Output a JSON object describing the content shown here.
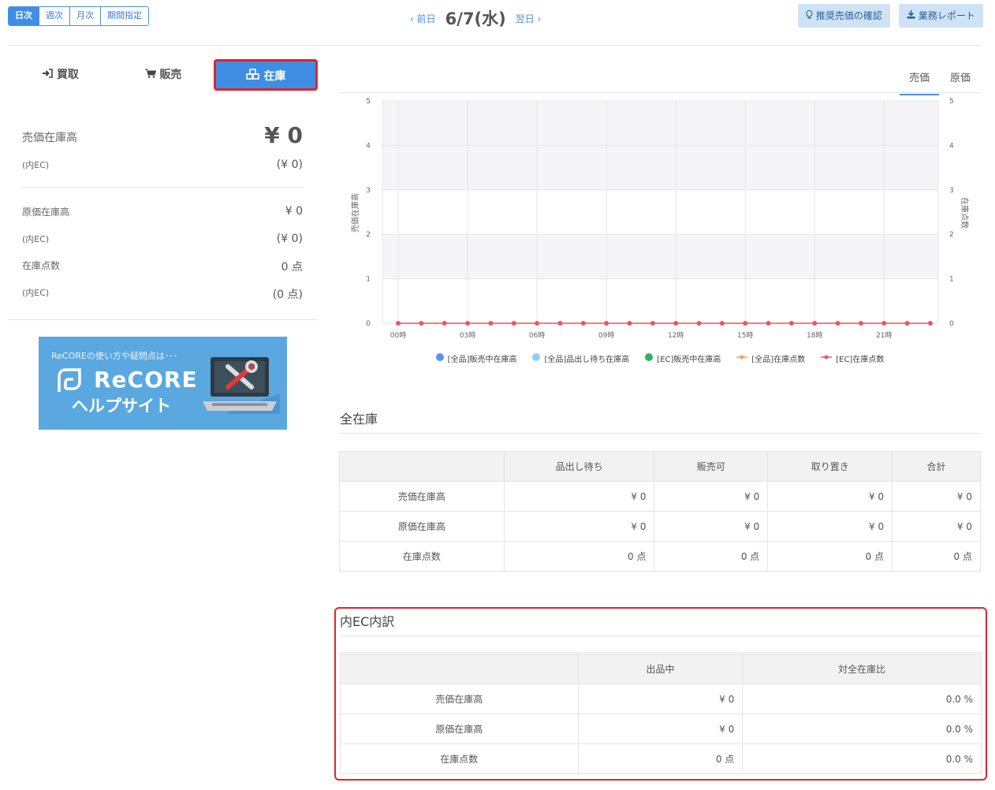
{
  "period": {
    "daily": "日次",
    "weekly": "週次",
    "monthly": "月次",
    "range": "期間指定"
  },
  "date_nav": {
    "prev": "前日",
    "current": "6/7(水)",
    "next": "翌日"
  },
  "top_buttons": {
    "recommend": "推奨売価の確認",
    "report": "業務レポート"
  },
  "left_tabs": {
    "buy": "買取",
    "sell": "販売",
    "stock": "在庫"
  },
  "summary": {
    "sale_stock_label": "売価在庫高",
    "sale_stock_value": "¥ 0",
    "sale_stock_ec_label": "(内EC)",
    "sale_stock_ec_value": "(¥ 0)",
    "cost_stock_label": "原価在庫高",
    "cost_stock_value": "¥ 0",
    "cost_stock_ec_label": "(内EC)",
    "cost_stock_ec_value": "(¥ 0)",
    "count_label": "在庫点数",
    "count_value": "0 点",
    "count_ec_label": "(内EC)",
    "count_ec_value": "(0 点)"
  },
  "banner": {
    "caption": "ReCOREの使い方や疑問点は･･･",
    "brand": "ReCORE",
    "site": "ヘルプサイト"
  },
  "chart_tabs": {
    "sale_price": "売価",
    "cost_price": "原価"
  },
  "chart_data": {
    "type": "line",
    "ylabel": "売価在庫高",
    "y2label": "在庫点数",
    "ylim": [
      0,
      5
    ],
    "y2lim": [
      0,
      5
    ],
    "yticks": [
      "0",
      "1",
      "2",
      "3",
      "4",
      "5"
    ],
    "x_tick_labels": [
      "00時",
      "03時",
      "06時",
      "09時",
      "12時",
      "15時",
      "18時",
      "21時"
    ],
    "x": [
      0,
      1,
      2,
      3,
      4,
      5,
      6,
      7,
      8,
      9,
      10,
      11,
      12,
      13,
      14,
      15,
      16,
      17,
      18,
      19,
      20,
      21,
      22,
      23
    ],
    "legend": [
      "[全品]販売中在庫高",
      "[全品]品出し待ち在庫高",
      "[EC]販売中在庫高",
      "[全品]在庫点数",
      "[EC]在庫点数"
    ],
    "legend_colors": [
      "#5b8ff9",
      "#91cef5",
      "#2fb463",
      "#f7a35c",
      "#f0545a"
    ],
    "series": [
      {
        "name": "[EC]在庫点数",
        "values": [
          0,
          0,
          0,
          0,
          0,
          0,
          0,
          0,
          0,
          0,
          0,
          0,
          0,
          0,
          0,
          0,
          0,
          0,
          0,
          0,
          0,
          0,
          0,
          0
        ]
      }
    ]
  },
  "all_stock": {
    "title": "全在庫",
    "columns": [
      "",
      "品出し待ち",
      "販売可",
      "取り置き",
      "合計"
    ],
    "rows": [
      [
        "売価在庫高",
        "¥ 0",
        "¥ 0",
        "¥ 0",
        "¥ 0"
      ],
      [
        "原価在庫高",
        "¥ 0",
        "¥ 0",
        "¥ 0",
        "¥ 0"
      ],
      [
        "在庫点数",
        "0 点",
        "0 点",
        "0 点",
        "0 点"
      ]
    ]
  },
  "ec_breakdown": {
    "title": "内EC内訳",
    "columns": [
      "",
      "出品中",
      "対全在庫比"
    ],
    "rows": [
      [
        "売価在庫高",
        "¥ 0",
        "0.0 %"
      ],
      [
        "原価在庫高",
        "¥ 0",
        "0.0 %"
      ],
      [
        "在庫点数",
        "0 点",
        "0.0 %"
      ]
    ]
  }
}
